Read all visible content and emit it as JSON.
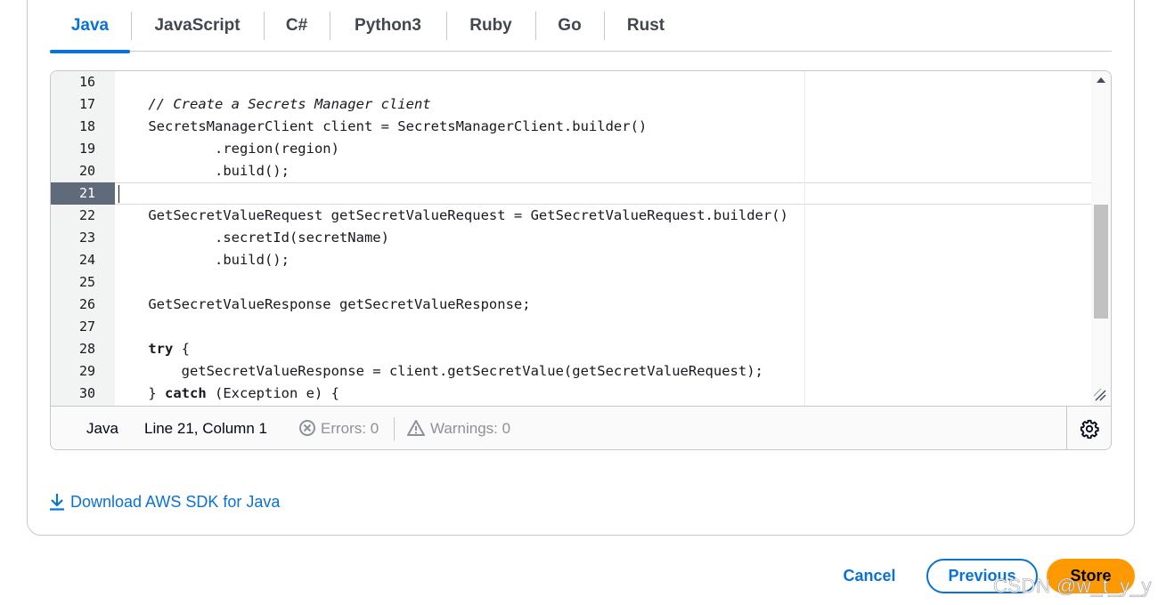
{
  "tabs": [
    {
      "label": "Java",
      "active": true
    },
    {
      "label": "JavaScript",
      "active": false
    },
    {
      "label": "C#",
      "active": false
    },
    {
      "label": "Python3",
      "active": false
    },
    {
      "label": "Ruby",
      "active": false
    },
    {
      "label": "Go",
      "active": false
    },
    {
      "label": "Rust",
      "active": false
    }
  ],
  "editor": {
    "active_line": "21",
    "lines": [
      {
        "num": "16",
        "text": ""
      },
      {
        "num": "17",
        "text": "    // Create a Secrets Manager client"
      },
      {
        "num": "18",
        "text": "    SecretsManagerClient client = SecretsManagerClient.builder()"
      },
      {
        "num": "19",
        "text": "            .region(region)"
      },
      {
        "num": "20",
        "text": "            .build();"
      },
      {
        "num": "21",
        "text": ""
      },
      {
        "num": "22",
        "text": "    GetSecretValueRequest getSecretValueRequest = GetSecretValueRequest.builder()"
      },
      {
        "num": "23",
        "text": "            .secretId(secretName)"
      },
      {
        "num": "24",
        "text": "            .build();"
      },
      {
        "num": "25",
        "text": ""
      },
      {
        "num": "26",
        "text": "    GetSecretValueResponse getSecretValueResponse;"
      },
      {
        "num": "27",
        "text": ""
      },
      {
        "num": "28",
        "text_parts": [
          "    ",
          "try",
          " {"
        ]
      },
      {
        "num": "29",
        "text": "        getSecretValueResponse = client.getSecretValue(getSecretValueRequest);"
      },
      {
        "num": "30",
        "text_parts": [
          "    } ",
          "catch",
          " (Exception e) {"
        ]
      }
    ]
  },
  "status": {
    "language": "Java",
    "position": "Line 21, Column 1",
    "errors": "Errors: 0",
    "warnings": "Warnings: 0"
  },
  "download_link": "Download AWS SDK for Java",
  "buttons": {
    "cancel": "Cancel",
    "previous": "Previous",
    "store": "Store"
  },
  "watermark": "CSDN @w_t_y_y",
  "colors": {
    "accent": "#0972d3",
    "primary_button": "#ff9900",
    "active_line_number": "#5f6b7a"
  }
}
